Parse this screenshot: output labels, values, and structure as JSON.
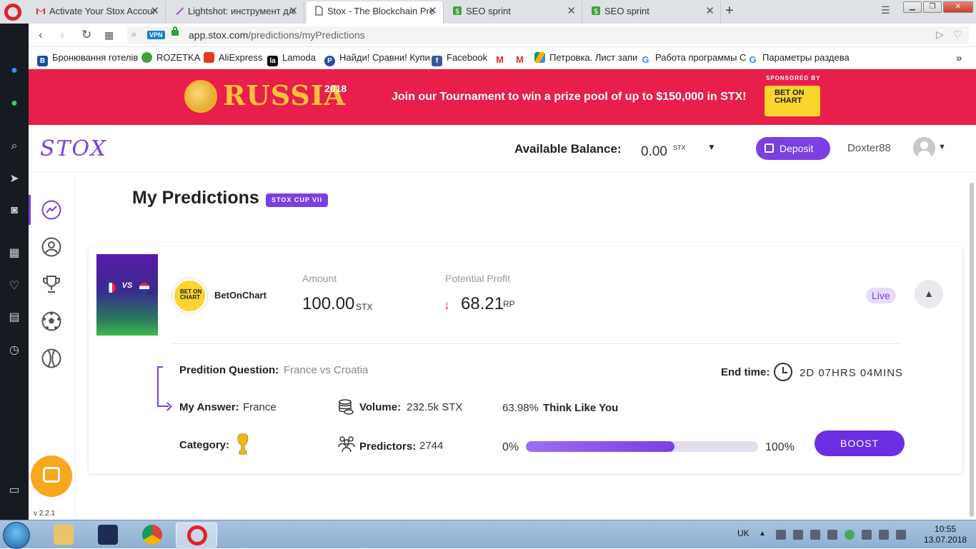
{
  "browser": {
    "tabs": [
      {
        "label": "Activate Your Stox Accoun",
        "icon": "gmail-icon",
        "active": false
      },
      {
        "label": "Lightshot: инструмент для",
        "icon": "lightshot-icon",
        "active": false
      },
      {
        "label": "Stox - The Blockchain Pred",
        "icon": "page-icon",
        "active": true
      },
      {
        "label": "SEO sprint",
        "icon": "seosprint-icon",
        "active": false
      },
      {
        "label": "SEO sprint",
        "icon": "seosprint-icon",
        "active": false
      }
    ],
    "vpn_label": "VPN",
    "url_domain": "app.stox.com",
    "url_path": "/predictions/myPredictions",
    "bookmarks": [
      {
        "label": "Бронювання готелів",
        "icon_letter": "B",
        "color": "#1a4fa0"
      },
      {
        "label": "ROZETKA",
        "icon_letter": "",
        "color": "#3fa13d"
      },
      {
        "label": "AliExpress",
        "icon_letter": "",
        "color": "#e23d23"
      },
      {
        "label": "Lamoda",
        "icon_letter": "la",
        "color": "#111111"
      },
      {
        "label": "Найди! Сравни! Купи",
        "icon_letter": "P",
        "color": "#2a4a9e"
      },
      {
        "label": "Facebook",
        "icon_letter": "f",
        "color": "#3b5998"
      },
      {
        "label": "",
        "icon_letter": "M",
        "color": "#d93025"
      },
      {
        "label": "",
        "icon_letter": "M",
        "color": "#d93025"
      },
      {
        "label": "Петровка. Лист запи",
        "icon_letter": "",
        "color": "#f4b400"
      },
      {
        "label": "Работа программы С",
        "icon_letter": "G",
        "color": "#4285f4"
      },
      {
        "label": "Параметры раздева",
        "icon_letter": "G",
        "color": "#4285f4"
      }
    ],
    "overflow_label": "»"
  },
  "banner": {
    "russia": "RUSSIA",
    "year": "2018",
    "headline": "Join our Tournament to win a prize pool of up to $150,000 in STX!",
    "sponsored_by": "SPONSORED BY",
    "sponsor_logo": "BET ON CHART"
  },
  "header": {
    "logo": "STOX",
    "balance_label": "Available Balance:",
    "balance_value": "0.00",
    "balance_unit": "STX",
    "deposit_label": "Deposit",
    "username": "Doxter88"
  },
  "page": {
    "title": "My Predictions",
    "badge": "STOX CUP VII"
  },
  "prediction": {
    "match_vs": "VS",
    "sponsor_circle_text": "BET ON CHART",
    "sponsor_name": "BetOnChart",
    "amount_label": "Amount",
    "amount_value": "100.00",
    "amount_unit": "STX",
    "profit_label": "Potential Profit",
    "profit_value": "68.21",
    "profit_unit": "RP",
    "status": "Live",
    "question_label": "Predition Question:",
    "question_value": "France vs Croatia",
    "end_label": "End time:",
    "end_value": "2D 07HRS 04MINS",
    "answer_label": "My Answer:",
    "answer_value": "France",
    "volume_label": "Volume:",
    "volume_value": "232.5k STX",
    "think_pct": "63.98%",
    "think_label": "Think Like You",
    "category_label": "Category:",
    "predictors_label": "Predictors:",
    "predictors_value": "2744",
    "progress_min": "0%",
    "progress_max": "100%",
    "progress_fraction": 0.6398,
    "boost_label": "BOOST"
  },
  "app_version": "v 2.2.1",
  "taskbar": {
    "lang": "UK",
    "time": "10:55",
    "date": "13.07.2018"
  },
  "colors": {
    "accent": "#7b3fe4",
    "banner": "#e81e4b",
    "sponsor_yellow": "#f8d62d"
  }
}
